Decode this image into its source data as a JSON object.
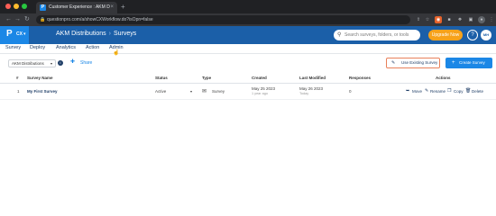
{
  "browser": {
    "tab_title": "Customer Experience : AKM D",
    "tab_favicon": "P",
    "tab_close": "×",
    "new_tab": "+",
    "url": "questionpro.com/a/showCXWorkflow.do?isOpn=false"
  },
  "header": {
    "logo_letter": "P",
    "logo_product": "CX",
    "breadcrumb": [
      "AKM Distributions",
      "Surveys"
    ],
    "search_placeholder": "Search surveys, folders, or tools",
    "upgrade_label": "Upgrade Now",
    "help_label": "?",
    "avatar_initials": "MH"
  },
  "menu": [
    "Survey",
    "Deploy",
    "Analytics",
    "Action",
    "Admin"
  ],
  "toolbar": {
    "distribution": "AKM Distributions",
    "share_label": "Share",
    "use_existing_label": "Use Existing Survey",
    "create_label": "Create Survey"
  },
  "table": {
    "columns": {
      "number": "#",
      "name": "Survey Name",
      "status": "Status",
      "type": "Type",
      "created": "Created",
      "last_modified": "Last Modified",
      "responses": "Responses",
      "actions": "Actions"
    },
    "rows": [
      {
        "number": "1",
        "name": "My First Survey",
        "status": "Active",
        "type": "Survey",
        "created": "May 25 2023",
        "created_ago": "1 year ago",
        "last_modified": "May 26 2023",
        "last_modified_ago": "Today",
        "responses": "0",
        "actions": [
          "Move",
          "Rename",
          "Copy",
          "Delete"
        ]
      }
    ]
  },
  "colors": {
    "header_bg": "#1b5fa8",
    "accent_blue": "#1b87e6",
    "upgrade_orange": "#f7a21b"
  }
}
